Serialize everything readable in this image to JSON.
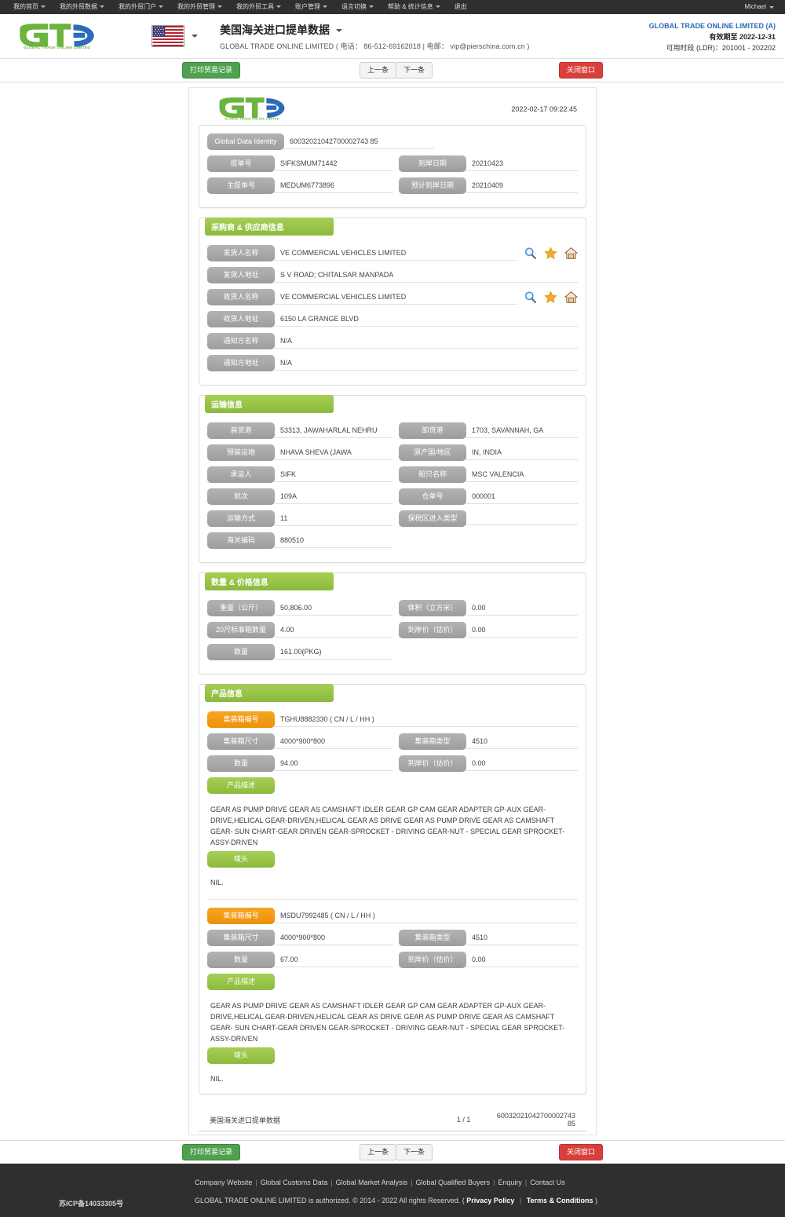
{
  "topnav": {
    "items": [
      {
        "label": "我的首页",
        "caret": true
      },
      {
        "label": "我的外贸数据",
        "caret": true
      },
      {
        "label": "我的外贸门户",
        "caret": true
      },
      {
        "label": "我的外贸管理",
        "caret": true
      },
      {
        "label": "我的外贸工具",
        "caret": true
      },
      {
        "label": "账户管理",
        "caret": true
      },
      {
        "label": "语言切换",
        "caret": true
      },
      {
        "label": "帮助 & 统计信息",
        "caret": true
      },
      {
        "label": "退出",
        "caret": false
      }
    ],
    "user": "Michael"
  },
  "header": {
    "logo_text": "GLOBAL TRADE ONLINE LIMITED",
    "flag_icon": "us-flag-icon",
    "title": "美国海关进口提单数据",
    "subtitle": "GLOBAL TRADE ONLINE LIMITED ( 电话： 86-512-69162018 | 电邮： vip@pierschina.com.cn )",
    "account_name": "GLOBAL TRADE ONLINE LIMITED (A)",
    "valid_until": "有效期至 2022-12-31",
    "ldr_range": "可用时段 (LDR)：201001 - 202202"
  },
  "toolbar": {
    "print_label": "打印贸易记录",
    "prev_label": "上一条",
    "next_label": "下一条",
    "close_label": "关闭窗口"
  },
  "document": {
    "timestamp": "2022-02-17 09:22:45",
    "identity": {
      "gdi_label": "Global Data Identity",
      "gdi_value": "60032021042700002743 85",
      "rows": [
        {
          "label": "提单号",
          "value": "SIFKSMUM71442",
          "label2": "到岸日期",
          "value2": "20210423"
        },
        {
          "label": "主提单号",
          "value": "MEDUM6773896",
          "label2": "预计到岸日期",
          "value2": "20210409"
        }
      ]
    },
    "buyer_supplier": {
      "title": "采购商 & 供应商信息",
      "rows": [
        {
          "label": "发货人名称",
          "value": "VE COMMERCIAL VEHICLES LIMITED",
          "icons": true
        },
        {
          "label": "发货人地址",
          "value": "S V ROAD; CHITALSAR MANPADA",
          "icons": false
        },
        {
          "label": "收货人名称",
          "value": "VE COMMERCIAL VEHICLES LIMITED",
          "icons": true
        },
        {
          "label": "收货人地址",
          "value": "6150 LA GRANGE BLVD",
          "icons": false
        },
        {
          "label": "通知方名称",
          "value": "N/A",
          "icons": false
        },
        {
          "label": "通知方地址",
          "value": "N/A",
          "icons": false
        }
      ]
    },
    "transport": {
      "title": "运输信息",
      "rows": [
        {
          "label": "装货港",
          "value": "53313, JAWAHARLAL NEHRU",
          "label2": "卸货港",
          "value2": "1703, SAVANNAH, GA"
        },
        {
          "label": "预装运地",
          "value": "NHAVA SHEVA (JAWA",
          "label2": "原产国/地区",
          "value2": "IN, INDIA"
        },
        {
          "label": "承运人",
          "value": "SIFK",
          "label2": "船只名称",
          "value2": "MSC VALENCIA"
        },
        {
          "label": "航次",
          "value": "109A",
          "label2": "仓单号",
          "value2": "000001"
        },
        {
          "label": "运输方式",
          "value": "11",
          "label2": "保税区进入类型",
          "value2": ""
        },
        {
          "label": "海关编码",
          "value": "880510",
          "label2": "",
          "value2": ""
        }
      ]
    },
    "quantity_price": {
      "title": "数量 & 价格信息",
      "rows": [
        {
          "label": "重量（公斤）",
          "value": "50,806.00",
          "label2": "体积（立方米）",
          "value2": "0.00"
        },
        {
          "label": "20尺标准箱数量",
          "value": "4.00",
          "label2": "到岸价（估价）",
          "value2": "0.00"
        },
        {
          "label": "数量",
          "value": "161.00(PKG)",
          "label2": "",
          "value2": ""
        }
      ]
    },
    "product_info": {
      "title": "产品信息",
      "labels": {
        "container_no": "集装箱编号",
        "container_size": "集装箱尺寸",
        "container_type": "集装箱类型",
        "quantity": "数量",
        "cif": "到岸价（估价）",
        "description": "产品描述",
        "marks": "唛头"
      },
      "items": [
        {
          "container_no": "TGHU8882330 ( CN / L / HH )",
          "container_size": "4000*900*800",
          "container_type": "4510",
          "quantity": "94.00",
          "cif": "0.00",
          "description": "GEAR AS PUMP DRIVE GEAR AS CAMSHAFT IDLER GEAR GP CAM GEAR ADAPTER GP-AUX GEAR-DRIVE,HELICAL GEAR-DRIVEN,HELICAL GEAR AS DRIVE GEAR AS PUMP DRIVE GEAR AS CAMSHAFT GEAR- SUN CHART-GEAR DRIVEN GEAR-SPROCKET - DRIVING GEAR-NUT - SPECIAL GEAR SPROCKET-ASSY-DRIVEN",
          "marks": "NIL."
        },
        {
          "container_no": "MSDU7992485 ( CN / L / HH )",
          "container_size": "4000*900*800",
          "container_type": "4510",
          "quantity": "67.00",
          "cif": "0.00",
          "description": "GEAR AS PUMP DRIVE GEAR AS CAMSHAFT IDLER GEAR GP CAM GEAR ADAPTER GP-AUX GEAR-DRIVE,HELICAL GEAR-DRIVEN,HELICAL GEAR AS DRIVE GEAR AS PUMP DRIVE GEAR AS CAMSHAFT GEAR- SUN CHART-GEAR DRIVEN GEAR-SPROCKET - DRIVING GEAR-NUT - SPECIAL GEAR SPROCKET-ASSY-DRIVEN",
          "marks": "NIL."
        }
      ]
    },
    "footer": {
      "source": "美国海关进口提单数据",
      "page": "1 / 1",
      "id": "60032021042700002743 85"
    }
  },
  "footer": {
    "icp": "苏ICP备14033305号",
    "links": [
      "Company Website",
      "Global Customs Data",
      "Global Market Analysis",
      "Global Qualified Buyers",
      "Enquiry",
      "Contact Us"
    ],
    "copy_prefix": "GLOBAL TRADE ONLINE LIMITED is authorized. © 2014 - 2022 All rights Reserved.  (",
    "privacy": "Privacy Policy",
    "terms": "Terms & Conditions",
    "copy_suffix": ")"
  },
  "colors": {
    "nav_bg": "#2f2f2f",
    "green": "#8cba3e",
    "orange": "#ef8f08",
    "gray_label": "#9d9d9d",
    "btn_green": "#4fa14f",
    "btn_red": "#d9403c",
    "link_blue": "#2b6cb8"
  }
}
